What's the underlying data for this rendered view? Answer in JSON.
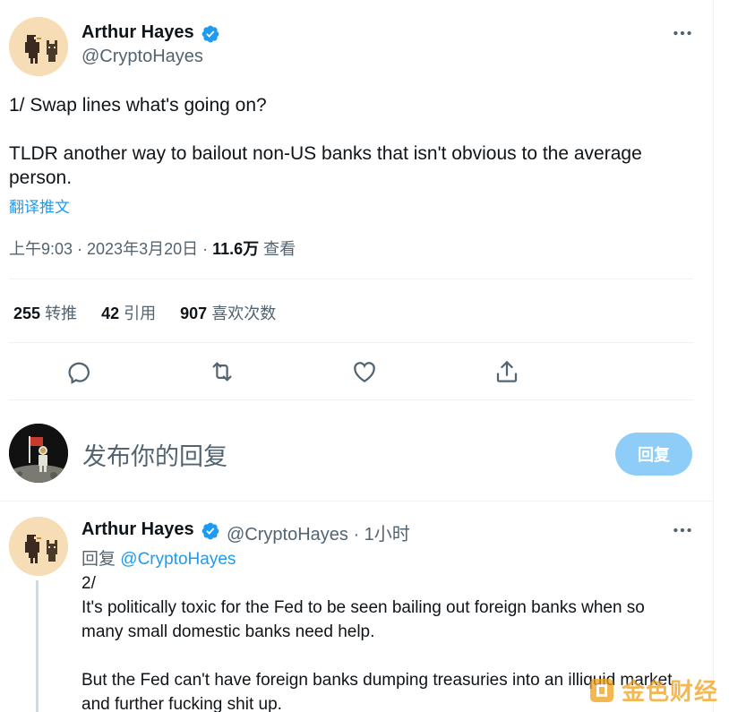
{
  "tweet": {
    "author_name": "Arthur Hayes",
    "author_handle": "@CryptoHayes",
    "text_line1": "1/ Swap lines what's going on?",
    "text_line2": "TLDR another way to bailout non-US banks that isn't obvious to the average person.",
    "translate_label": "翻译推文",
    "time": "上午9:03 · 2023年3月20日 · ",
    "views_count": "11.6万",
    "views_label": " 查看",
    "stats": [
      {
        "count": "255",
        "label": "转推"
      },
      {
        "count": "42",
        "label": "引用"
      },
      {
        "count": "907",
        "label": "喜欢次数"
      }
    ],
    "icons": [
      "reply-icon",
      "retweet-icon",
      "like-icon",
      "share-icon"
    ]
  },
  "compose": {
    "placeholder": "发布你的回复",
    "button_label": "回复"
  },
  "reply": {
    "author_name": "Arthur Hayes",
    "author_handle": "@CryptoHayes",
    "time_ago": " · 1小时",
    "replying_prefix": "回复 ",
    "replying_mention": "@CryptoHayes",
    "line1": "2/",
    "line2": "It's politically toxic for the Fed to be seen bailing out foreign banks when so many small domestic banks need help.",
    "line3": "But the Fed can't have foreign banks dumping treasuries into an illiquid market and further fucking shit up."
  },
  "watermark": {
    "text": "金色财经"
  },
  "colors": {
    "accent": "#1d9bf0",
    "muted": "#536471",
    "reply_button_disabled": "#8ecdf8",
    "avatar_bg": "#f7ddb6",
    "watermark": "#f0a11a"
  }
}
